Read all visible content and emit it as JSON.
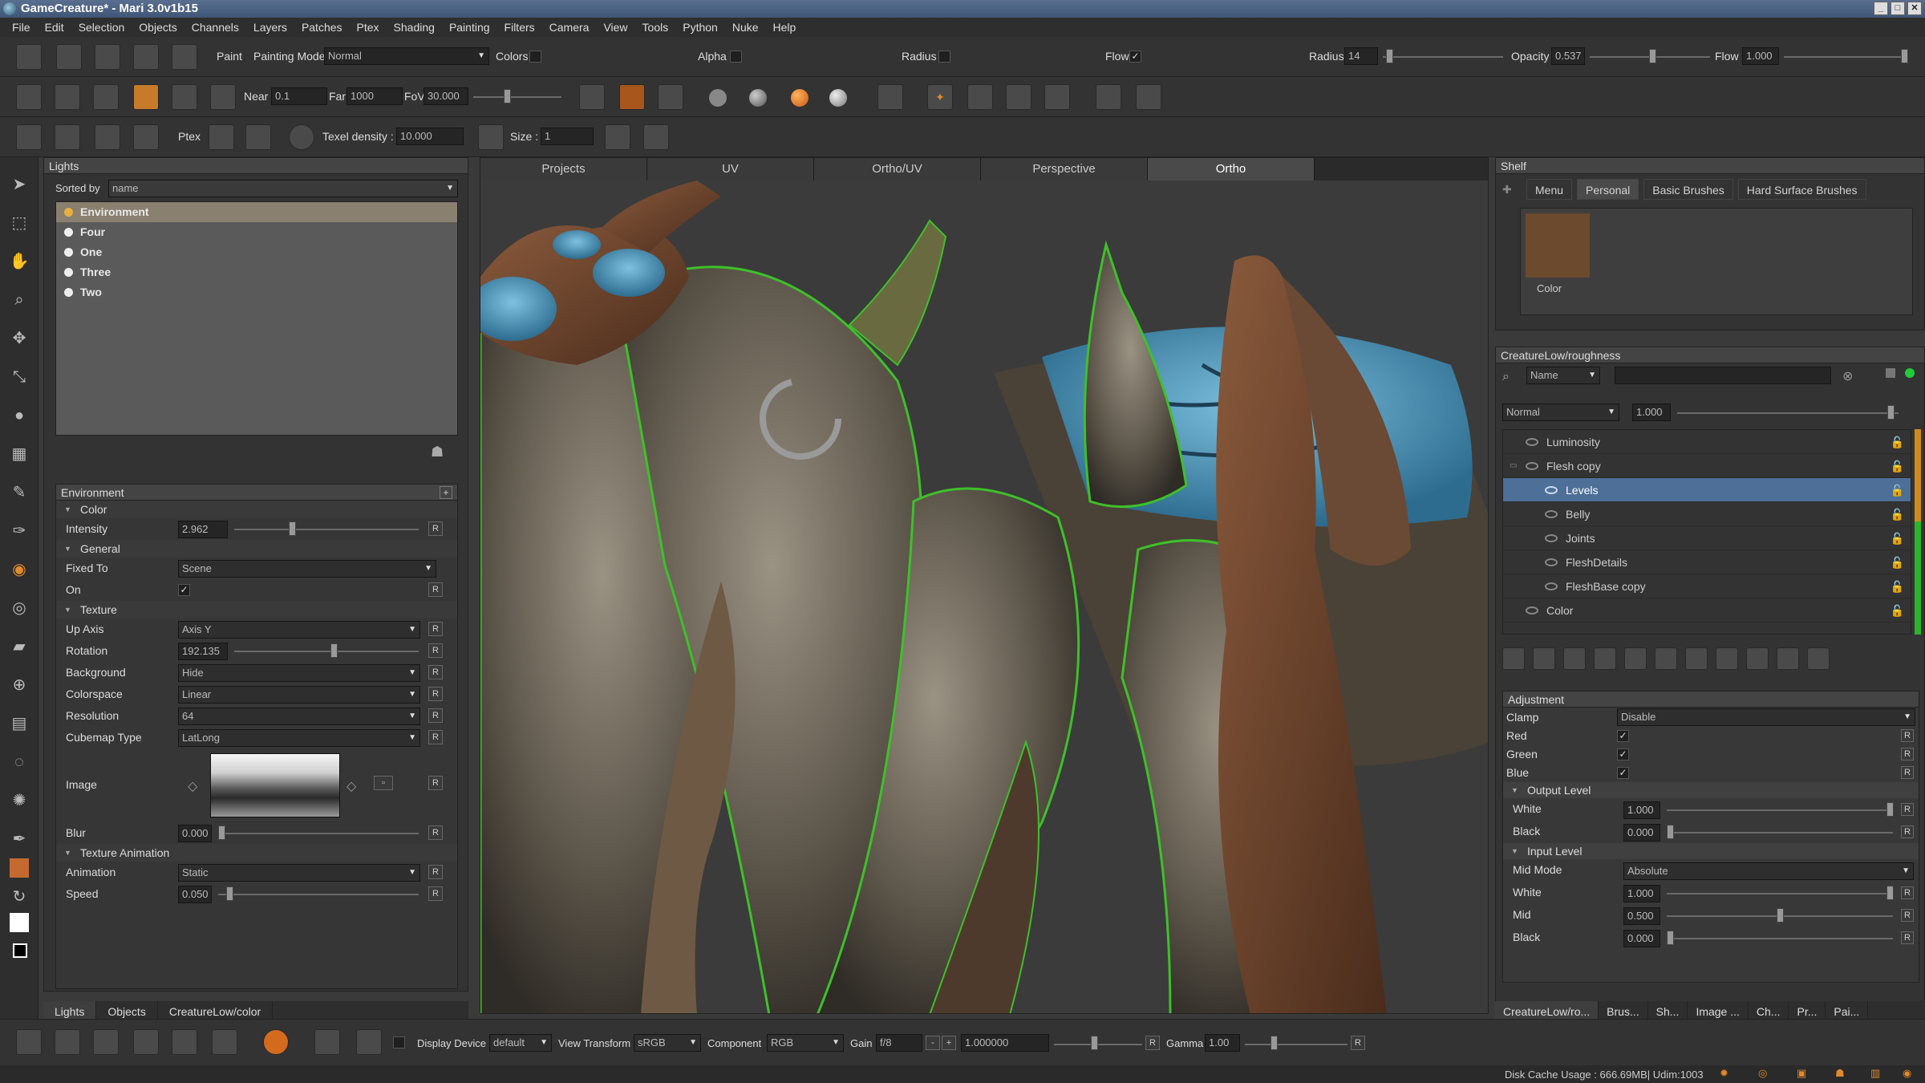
{
  "window": {
    "title": "GameCreature* - Mari 3.0v1b15"
  },
  "menu": [
    "File",
    "Edit",
    "Selection",
    "Objects",
    "Channels",
    "Layers",
    "Patches",
    "Ptex",
    "Shading",
    "Painting",
    "Filters",
    "Camera",
    "View",
    "Tools",
    "Python",
    "Nuke",
    "Help"
  ],
  "toolbar": {
    "paint_label": "Paint",
    "painting_mode_label": "Painting Mode",
    "painting_mode_value": "Normal",
    "colors_label": "Colors",
    "alpha_label": "Alpha",
    "radius_label": "Radius",
    "flow_label": "Flow",
    "radius2_label": "Radius",
    "radius2_value": "14",
    "opacity_label": "Opacity",
    "opacity_value": "0.537",
    "flow2_label": "Flow",
    "flow2_value": "1.000",
    "near_label": "Near",
    "near_value": "0.1",
    "far_label": "Far",
    "far_value": "1000",
    "fov_label": "FoV",
    "fov_value": "30.000",
    "ptex_label": "Ptex",
    "texel_density_label": "Texel density :",
    "texel_density_value": "10.000",
    "size_label": "Size :",
    "size_value": "1"
  },
  "lights": {
    "title": "Lights",
    "sorted_by_label": "Sorted by",
    "sorted_by_value": "name",
    "items": [
      "Environment",
      "Four",
      "One",
      "Three",
      "Two"
    ]
  },
  "environment": {
    "title": "Environment",
    "color_section": "Color",
    "intensity_label": "Intensity",
    "intensity_value": "2.962",
    "general_section": "General",
    "fixed_to_label": "Fixed To",
    "fixed_to_value": "Scene",
    "on_label": "On",
    "texture_section": "Texture",
    "up_axis_label": "Up Axis",
    "up_axis_value": "Axis Y",
    "rotation_label": "Rotation",
    "rotation_value": "192.135",
    "background_label": "Background",
    "background_value": "Hide",
    "colorspace_label": "Colorspace",
    "colorspace_value": "Linear",
    "resolution_label": "Resolution",
    "resolution_value": "64",
    "cubemap_label": "Cubemap Type",
    "cubemap_value": "LatLong",
    "image_label": "Image",
    "blur_label": "Blur",
    "blur_value": "0.000",
    "tex_anim_section": "Texture Animation",
    "animation_label": "Animation",
    "animation_value": "Static",
    "speed_label": "Speed",
    "speed_value": "0.050",
    "r": "R"
  },
  "left_tabs": [
    "Lights",
    "Objects",
    "CreatureLow/color"
  ],
  "viewport_tabs": [
    "Projects",
    "UV",
    "Ortho/UV",
    "Perspective",
    "Ortho"
  ],
  "shelf": {
    "title": "Shelf",
    "tabs": [
      "Menu",
      "Personal",
      "Basic Brushes",
      "Hard Surface Brushes"
    ],
    "swatch_label": "Color",
    "swatch_color": "#6b4a2e"
  },
  "layers": {
    "title": "CreatureLow/roughness",
    "filter_label": "Name",
    "blend_mode": "Normal",
    "opacity": "1.000",
    "items": [
      {
        "name": "Luminosity",
        "indent": 0
      },
      {
        "name": "Flesh copy",
        "indent": 0
      },
      {
        "name": "Levels",
        "indent": 1
      },
      {
        "name": "Belly",
        "indent": 1
      },
      {
        "name": "Joints",
        "indent": 1
      },
      {
        "name": "FleshDetails",
        "indent": 1
      },
      {
        "name": "FleshBase copy",
        "indent": 1
      },
      {
        "name": "Color",
        "indent": 0
      }
    ]
  },
  "adjustment": {
    "title": "Adjustment",
    "clamp_label": "Clamp",
    "clamp_value": "Disable",
    "red_label": "Red",
    "green_label": "Green",
    "blue_label": "Blue",
    "output_level": "Output Level",
    "white_label": "White",
    "white_value": "1.000",
    "black_label": "Black",
    "black_value": "0.000",
    "input_level": "Input Level",
    "mid_mode_label": "Mid Mode",
    "mid_mode_value": "Absolute",
    "in_white_label": "White",
    "in_white_value": "1.000",
    "mid_label": "Mid",
    "mid_value": "0.500",
    "in_black_label": "Black",
    "in_black_value": "0.000"
  },
  "right_tabs": [
    "CreatureLow/ro...",
    "Brus...",
    "Sh...",
    "Image ...",
    "Ch...",
    "Pr...",
    "Pai..."
  ],
  "bottom": {
    "display_device_label": "Display Device",
    "display_device_value": "default",
    "view_transform_label": "View Transform",
    "view_transform_value": "sRGB",
    "component_label": "Component",
    "component_value": "RGB",
    "gain_label": "Gain",
    "gain_value": "f/8",
    "gain_num": "1.000000",
    "gamma_label": "Gamma",
    "gamma_value": "1.00"
  },
  "status": {
    "disk_cache": "Disk Cache Usage : 666.69MB| Udim:1003"
  }
}
